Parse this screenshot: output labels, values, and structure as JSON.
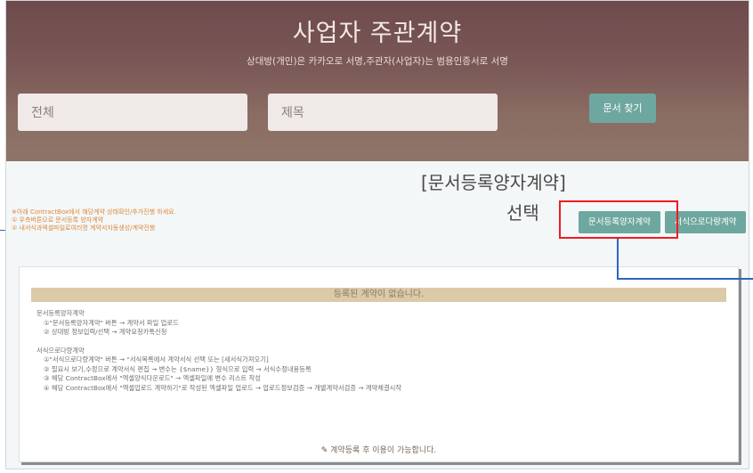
{
  "hero": {
    "title": "사업자 주관계약",
    "subtitle": "상대방(개인)은 카카오로 서명,주관자(사업자)는 범용인증서로 서명"
  },
  "search": {
    "field1_placeholder": "전체",
    "field2_placeholder": "제목",
    "button_label": "문서 찾기"
  },
  "callout": {
    "line1": "[문서등록양자계약]",
    "line2": "선택"
  },
  "notes": [
    "※아래 ContractBox에서 해당계약 상태확인/추가진행 하세요.",
    "① 우측버튼으로 문서등록 양자계약",
    "② 내서식과엑셀파일로여러명 계약서자동생성/계약진행"
  ],
  "actions": {
    "register_label": "문서등록양자계약",
    "form_label": "서식으로다량계약"
  },
  "panel": {
    "empty_message": "등록된 계약이 없습니다.",
    "guide": [
      {
        "text": "문서등록양자계약",
        "indent": false
      },
      {
        "text": "①\"문서등록양자계약\" 버튼 → 계약서 파일 업로드",
        "indent": true
      },
      {
        "text": "② 상대방 정보입력/선택 → 계약요청카톡신청",
        "indent": true
      },
      {
        "text": "",
        "indent": false
      },
      {
        "text": "서식으로다량계약",
        "indent": false
      },
      {
        "text": "①\"서식으로다량계약\" 버튼 → \"서식목록에서 계약서식 선택 또는 [새서식가져오기]",
        "indent": true
      },
      {
        "text": "② 필요시 보기,수정으로 계약서식 편집 → 변수는 {$name}} 형식으로 입력 → 서식수정내용등록",
        "indent": true
      },
      {
        "text": "③ 해당 ContractBox에서 \"엑셀양식다운로드\" → 엑셀파일에 변수 리스트 작성",
        "indent": true
      },
      {
        "text": "④ 해당 ContractBox에서 \"엑셀업로드 계약하기\"로 작성된 엑셀파일 업로드 → 업로드정보검증 → 개별계약서검증 → 계약체결시작",
        "indent": true
      }
    ],
    "footer": "계약등록 후 이용이 가능합니다.",
    "footer_icon": "pencil-icon"
  },
  "colors": {
    "accent_green": "#6ea79f",
    "highlight_red": "#ee1c24",
    "connector_blue": "#2b66c0",
    "notes_orange": "#e0883a",
    "header_tan": "#dcc9a8"
  }
}
